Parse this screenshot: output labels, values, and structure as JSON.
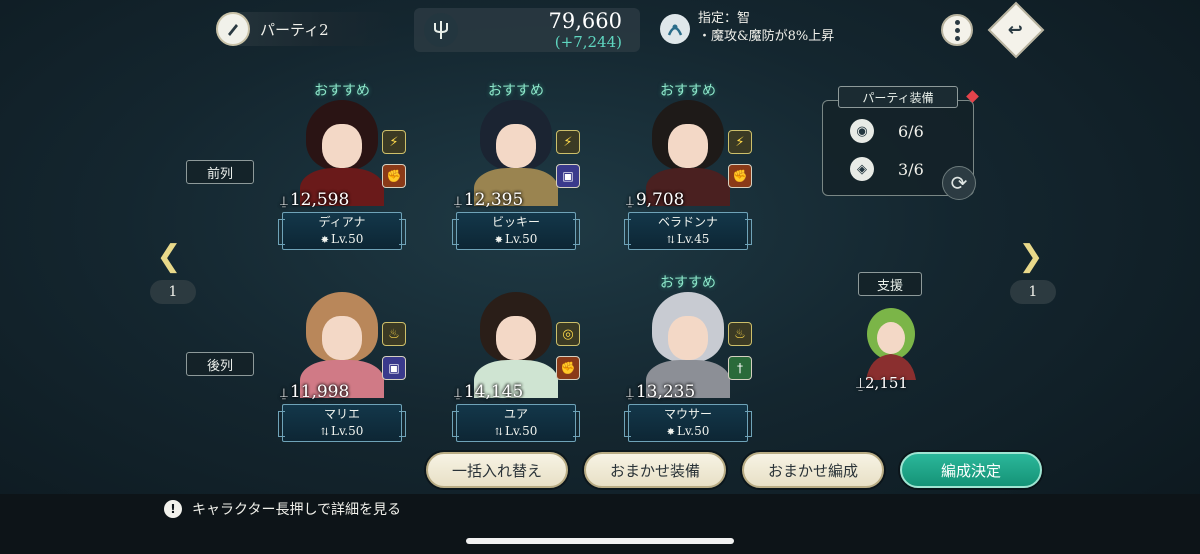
{
  "top_bar": {
    "party_name": "パーティ2",
    "total_power": "79,660",
    "power_diff": "(+7,244)",
    "bonus_line1": "指定：智",
    "bonus_line2": "・魔攻&魔防が8%上昇"
  },
  "rows": {
    "front_label": "前列",
    "back_label": "後列"
  },
  "recommend_label": "おすすめ",
  "characters": [
    {
      "name": "ディアナ",
      "power": "12,598",
      "level": "Lv.50",
      "star": "✸",
      "recommended": true,
      "element": "⚡",
      "weapon": "✊",
      "hair": "#2a1414",
      "outfit": "#6a1a1a",
      "weapon_bg": "#8a3a18"
    },
    {
      "name": "ビッキー",
      "power": "12,395",
      "level": "Lv.50",
      "star": "✸",
      "recommended": true,
      "element": "⚡",
      "weapon": "▣",
      "hair": "#1b2432",
      "outfit": "#9a8450",
      "weapon_bg": "#3a3a8c"
    },
    {
      "name": "ベラドンナ",
      "power": "9,708",
      "level": "Lv.45",
      "star": "⇅",
      "recommended": true,
      "element": "⚡",
      "weapon": "✊",
      "hair": "#1e1a18",
      "outfit": "#4a2020",
      "weapon_bg": "#8a3a18"
    },
    {
      "name": "マリエ",
      "power": "11,998",
      "level": "Lv.50",
      "star": "⇅",
      "recommended": false,
      "element": "♨",
      "weapon": "▣",
      "hair": "#b9875a",
      "outfit": "#d07a86",
      "weapon_bg": "#3a3a8c"
    },
    {
      "name": "ユア",
      "power": "14,145",
      "level": "Lv.50",
      "star": "⇅",
      "recommended": false,
      "element": "◎",
      "weapon": "✊",
      "hair": "#2a1e18",
      "outfit": "#cfe4d2",
      "weapon_bg": "#8a3a18"
    },
    {
      "name": "マウサー",
      "power": "13,235",
      "level": "Lv.50",
      "star": "✸",
      "recommended": true,
      "element": "♨",
      "weapon": "†",
      "hair": "#c8cbd2",
      "outfit": "#8c8f96",
      "weapon_bg": "#2a6a3a"
    }
  ],
  "page": {
    "left_num": "1",
    "right_num": "1"
  },
  "equipment": {
    "title": "パーティ装備",
    "row1_value": "6/6",
    "row2_value": "3/6"
  },
  "support": {
    "label": "支援",
    "power": "2,151"
  },
  "buttons": {
    "swap_all": "一括入れ替え",
    "auto_equip": "おまかせ装備",
    "auto_form": "おまかせ編成",
    "confirm": "編成決定"
  },
  "footer": {
    "hint": "キャラクター長押しで詳細を見る"
  },
  "colors": {
    "accent": "#1fa88a",
    "recommend": "#8de6c9",
    "power_diff": "#5fd6c0"
  }
}
